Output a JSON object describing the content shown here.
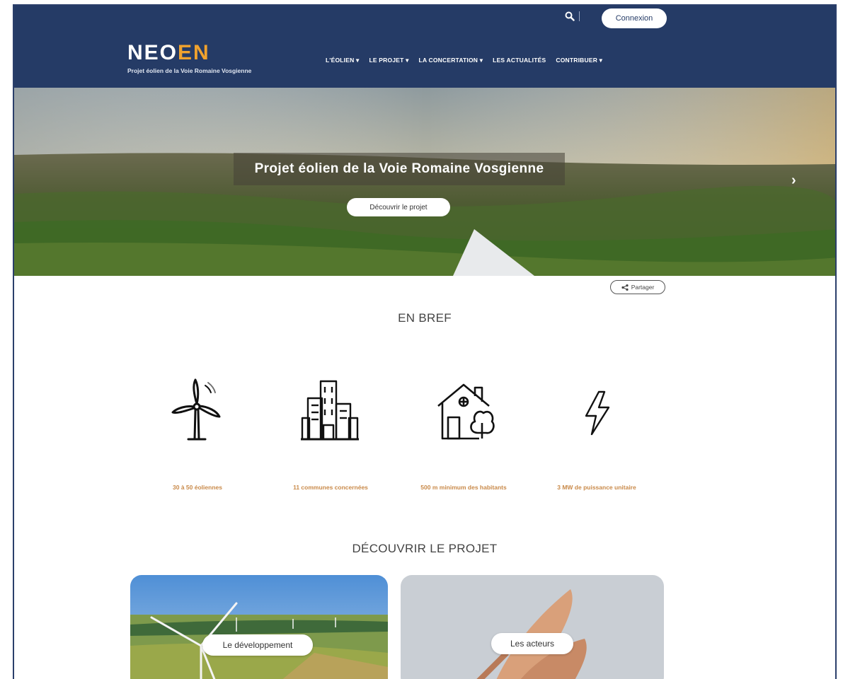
{
  "header": {
    "login_label": "Connexion",
    "logo_part1": "NEO",
    "logo_part2": "EN",
    "logo_subtitle": "Projet éolien de la Voie Romaine Vosgienne",
    "nav": [
      "L'ÉOLIEN ▾",
      "LE PROJET ▾",
      "LA CONCERTATION ▾",
      "LES ACTUALITÉS",
      "CONTRIBUER ▾"
    ]
  },
  "hero": {
    "title": "Projet éolien de la Voie Romaine Vosgienne",
    "cta": "Découvrir le projet",
    "next_icon": "chevron-right-icon"
  },
  "share_label": "Partager",
  "en_bref": {
    "title": "EN BREF",
    "facts": [
      {
        "icon": "wind-turbine-icon",
        "label": "30 à 50 éoliennes"
      },
      {
        "icon": "buildings-icon",
        "label": "11 communes concernées"
      },
      {
        "icon": "house-tree-icon",
        "label": "500 m minimum des habitants"
      },
      {
        "icon": "lightning-icon",
        "label": "3 MW de puissance unitaire"
      }
    ]
  },
  "decouvrir": {
    "title": "DÉCOUVRIR LE PROJET",
    "cards": [
      {
        "label": "Le développement"
      },
      {
        "label": "Les acteurs"
      }
    ]
  },
  "colors": {
    "header_bg": "#253b66",
    "logo_accent": "#f0a22e",
    "fact_label": "#c98a4a"
  }
}
